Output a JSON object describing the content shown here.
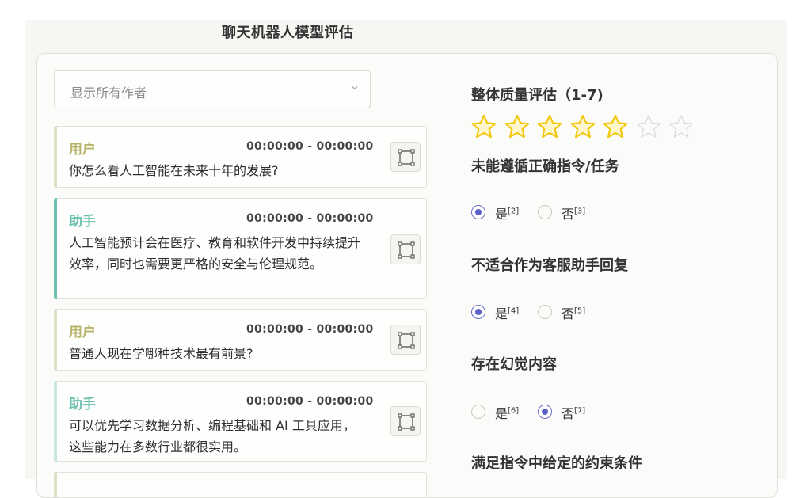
{
  "app": {
    "title": "聊天机器人模型评估"
  },
  "filter": {
    "placeholder": "显示所有作者"
  },
  "messages": [
    {
      "role": "用户",
      "time": "00:00:00 - 00:00:00",
      "text": "你怎么看人工智能在未来十年的发展?"
    },
    {
      "role": "助手",
      "time": "00:00:00 - 00:00:00",
      "text": "人工智能预计会在医疗、教育和软件开发中持续提升效率，同时也需要更严格的安全与伦理规范。"
    },
    {
      "role": "用户",
      "time": "00:00:00 - 00:00:00",
      "text": "普通人现在学哪种技术最有前景?"
    },
    {
      "role": "助手",
      "time": "00:00:00 - 00:00:00",
      "text": "可以优先学习数据分析、编程基础和 AI 工具应用，这些能力在多数行业都很实用。"
    }
  ],
  "rating": {
    "label": "整体质量评估（1-7)",
    "value": 5,
    "max": 7,
    "filled_color": "#f2c811",
    "empty_color": "#dcdcdc"
  },
  "questions": [
    {
      "label": "未能遵循正确指令/任务",
      "yes": "是",
      "yes_ref": "[2]",
      "no": "否",
      "no_ref": "[3]",
      "selected": "yes"
    },
    {
      "label": "不适合作为客服助手回复",
      "yes": "是",
      "yes_ref": "[4]",
      "no": "否",
      "no_ref": "[5]",
      "selected": "yes"
    },
    {
      "label": "存在幻觉内容",
      "yes": "是",
      "yes_ref": "[6]",
      "no": "否",
      "no_ref": "[7]",
      "selected": "no"
    },
    {
      "label": "满足指令中给定的约束条件"
    }
  ]
}
